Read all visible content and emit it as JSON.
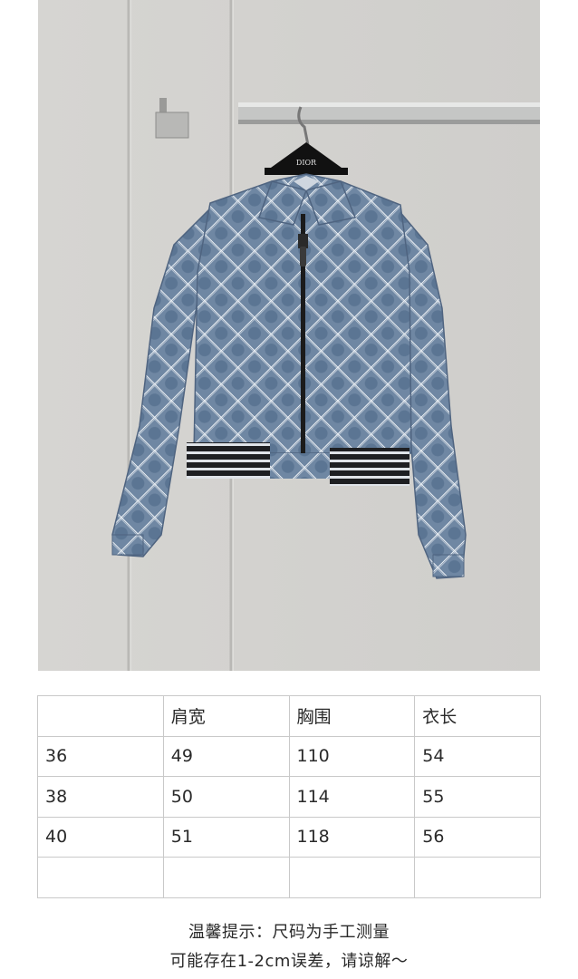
{
  "photo": {
    "hanger_logo": "DIOR",
    "colors": {
      "wall": "#d3d2cf",
      "wall_panel_line": "#b9b8b5",
      "fabric": "#6f87a3",
      "fabric_dark": "#4f6480",
      "pattern": "#eef2f6",
      "zipper": "#1b1b1b",
      "rib_black": "#1e1f22",
      "rib_white": "#dfe3e8"
    }
  },
  "size_table": {
    "headers": [
      "",
      "肩宽",
      "胸围",
      "衣长"
    ],
    "rows": [
      [
        "36",
        "49",
        "110",
        "54"
      ],
      [
        "38",
        "50",
        "114",
        "55"
      ],
      [
        "40",
        "51",
        "118",
        "56"
      ],
      [
        "",
        "",
        "",
        ""
      ]
    ]
  },
  "notice": {
    "line1": "温馨提示：尺码为手工测量",
    "line2": "可能存在1-2cm误差，请谅解～"
  }
}
